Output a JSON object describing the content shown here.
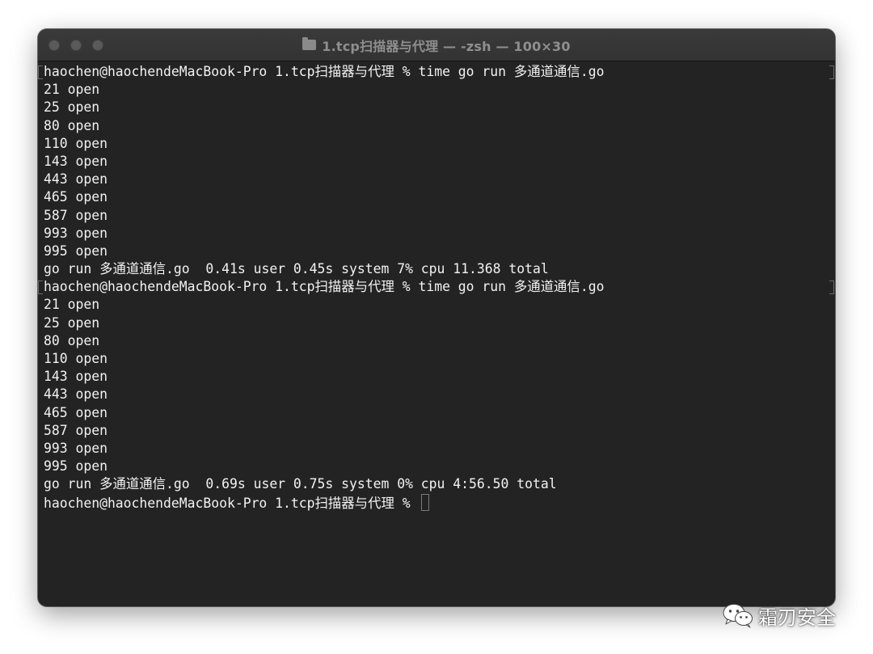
{
  "window": {
    "title": "1.tcp扫描器与代理 — -zsh — 100×30"
  },
  "terminal": {
    "lines": [
      "haochen@haochendeMacBook-Pro 1.tcp扫描器与代理 % time go run 多通道通信.go",
      "21 open",
      "25 open",
      "80 open",
      "110 open",
      "143 open",
      "443 open",
      "465 open",
      "587 open",
      "993 open",
      "995 open",
      "go run 多通道通信.go  0.41s user 0.45s system 7% cpu 11.368 total",
      "haochen@haochendeMacBook-Pro 1.tcp扫描器与代理 % time go run 多通道通信.go",
      "21 open",
      "25 open",
      "80 open",
      "110 open",
      "143 open",
      "443 open",
      "465 open",
      "587 open",
      "993 open",
      "995 open",
      "go run 多通道通信.go  0.69s user 0.75s system 0% cpu 4:56.50 total",
      "haochen@haochendeMacBook-Pro 1.tcp扫描器与代理 % "
    ]
  },
  "watermark": {
    "text": "霜刃安全",
    "icon": "wechat-icon"
  },
  "colors": {
    "background": "#232323",
    "text": "#f2f2f2",
    "titlebar": "#363636",
    "title_text": "#8f8f8f"
  }
}
